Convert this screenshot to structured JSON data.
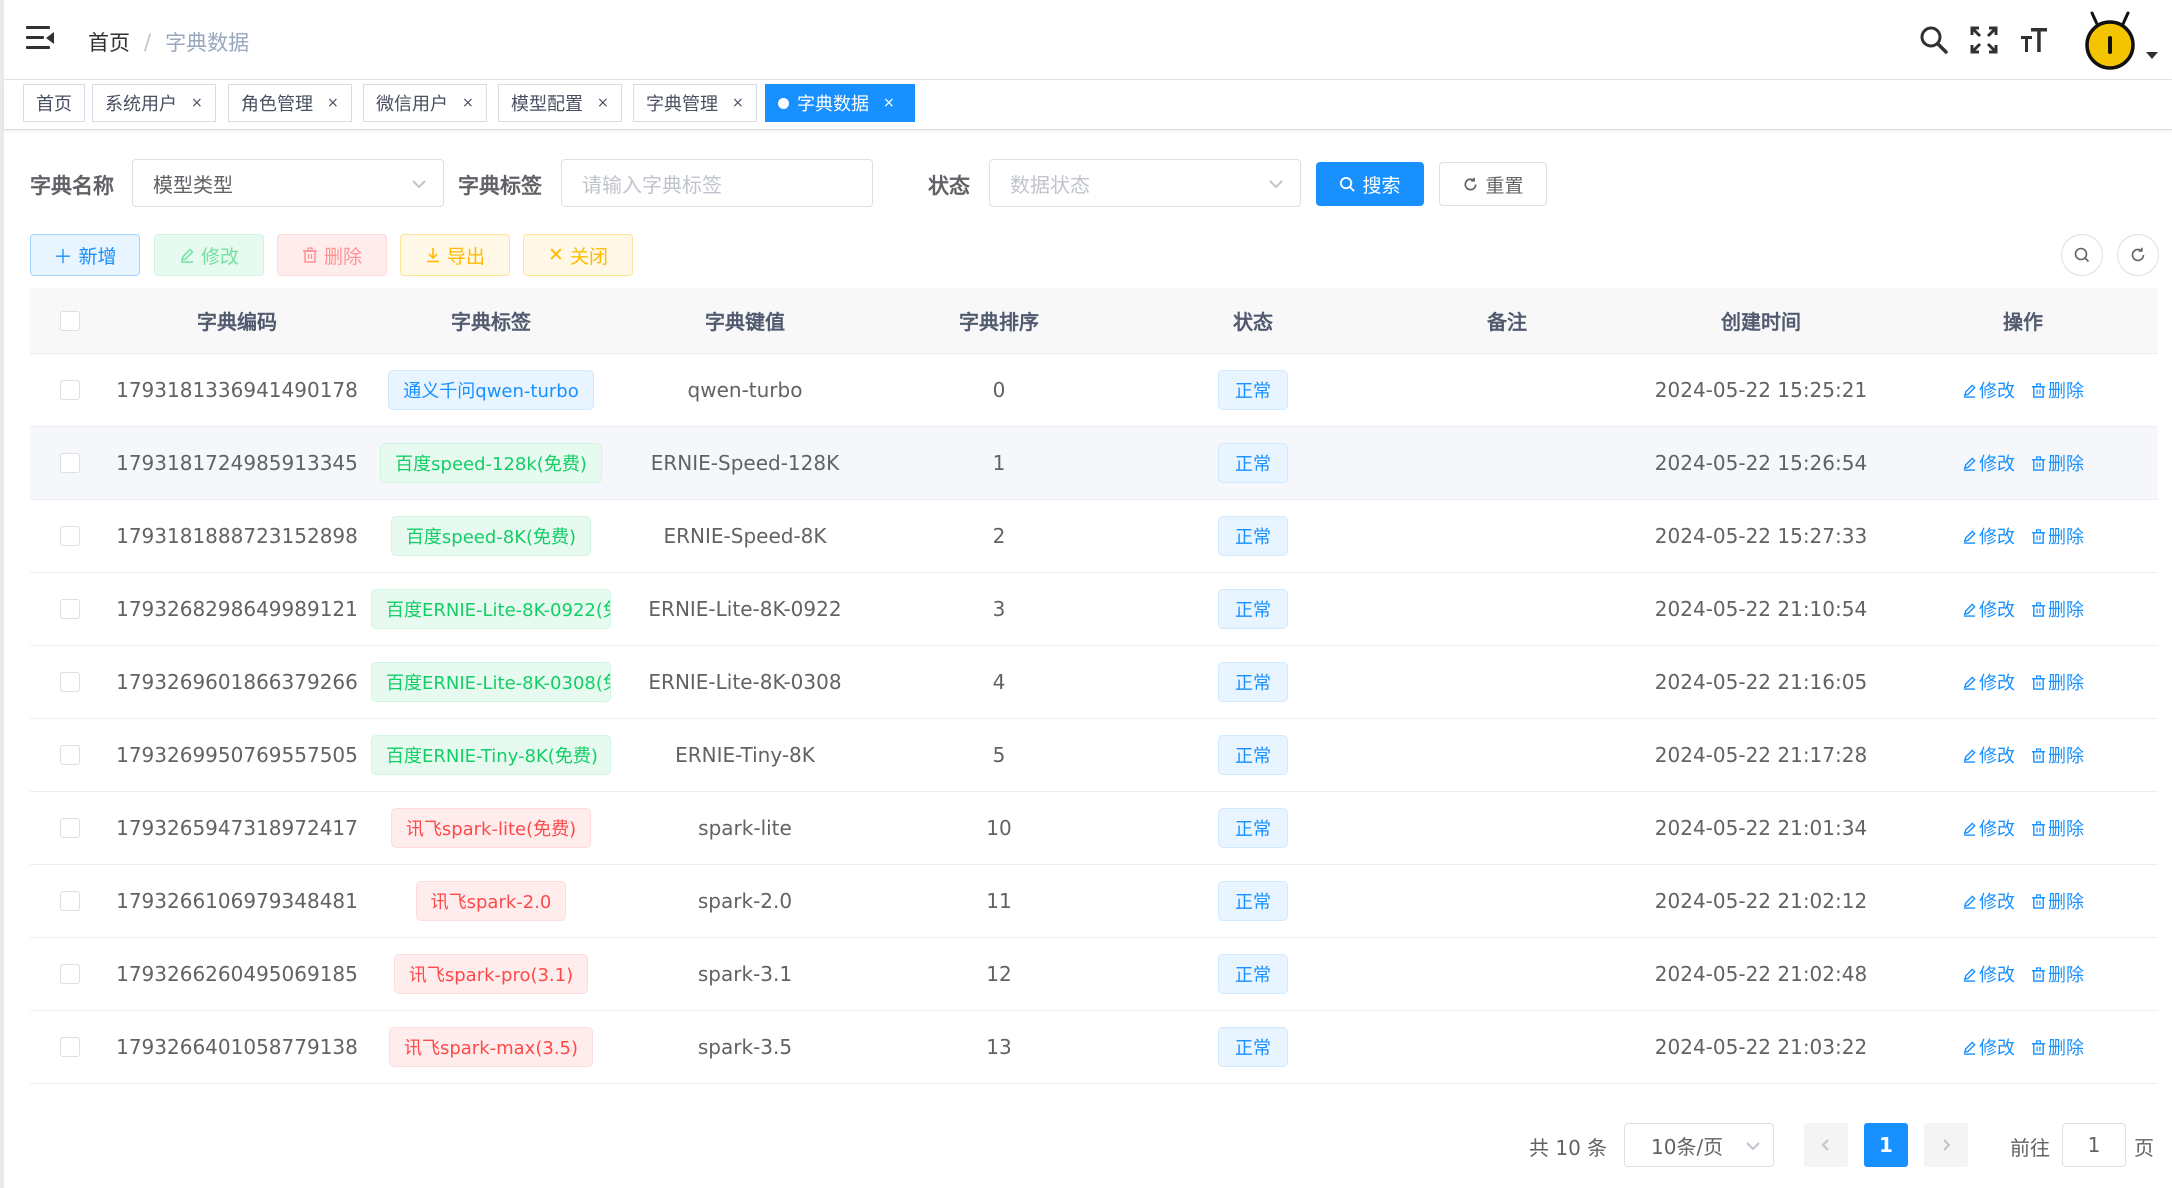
{
  "breadcrumb": {
    "home": "首页",
    "separator": "/",
    "current": "字典数据"
  },
  "tags": [
    {
      "label": "首页",
      "closable": false
    },
    {
      "label": "系统用户",
      "closable": true
    },
    {
      "label": "角色管理",
      "closable": true
    },
    {
      "label": "微信用户",
      "closable": true
    },
    {
      "label": "模型配置",
      "closable": true
    },
    {
      "label": "字典管理",
      "closable": true
    },
    {
      "label": "字典数据",
      "closable": true,
      "active": true
    }
  ],
  "tag_close": "×",
  "search": {
    "dict_name_label": "字典名称",
    "dict_name_value": "模型类型",
    "dict_label_label": "字典标签",
    "dict_label_placeholder": "请输入字典标签",
    "status_label": "状态",
    "status_placeholder": "数据状态",
    "search_button": "搜索",
    "reset_button": "重置"
  },
  "toolbar": {
    "add": "新增",
    "edit": "修改",
    "delete": "删除",
    "export": "导出",
    "close": "关闭"
  },
  "table": {
    "columns": [
      "字典编码",
      "字典标签",
      "字典键值",
      "字典排序",
      "状态",
      "备注",
      "创建时间",
      "操作"
    ],
    "rows": [
      {
        "code": "1793181336941490178",
        "label": "通义千问qwen-turbo",
        "label_type": "primary",
        "value": "qwen-turbo",
        "sort": "0",
        "status": "正常",
        "remark": "",
        "created": "2024-05-22 15:25:21"
      },
      {
        "code": "1793181724985913345",
        "label": "百度speed-128k(免费)",
        "label_type": "success",
        "value": "ERNIE-Speed-128K",
        "sort": "1",
        "status": "正常",
        "remark": "",
        "created": "2024-05-22 15:26:54"
      },
      {
        "code": "1793181888723152898",
        "label": "百度speed-8K(免费)",
        "label_type": "success",
        "value": "ERNIE-Speed-8K",
        "sort": "2",
        "status": "正常",
        "remark": "",
        "created": "2024-05-22 15:27:33"
      },
      {
        "code": "1793268298649989121",
        "label": "百度ERNIE-Lite-8K-0922(免",
        "label_type": "success",
        "value": "ERNIE-Lite-8K-0922",
        "sort": "3",
        "status": "正常",
        "remark": "",
        "created": "2024-05-22 21:10:54"
      },
      {
        "code": "1793269601866379266",
        "label": "百度ERNIE-Lite-8K-0308(免",
        "label_type": "success",
        "value": "ERNIE-Lite-8K-0308",
        "sort": "4",
        "status": "正常",
        "remark": "",
        "created": "2024-05-22 21:16:05"
      },
      {
        "code": "1793269950769557505",
        "label": "百度ERNIE-Tiny-8K(免费)",
        "label_type": "success",
        "value": "ERNIE-Tiny-8K",
        "sort": "5",
        "status": "正常",
        "remark": "",
        "created": "2024-05-22 21:17:28"
      },
      {
        "code": "1793265947318972417",
        "label": "讯飞spark-lite(免费)",
        "label_type": "danger",
        "value": "spark-lite",
        "sort": "10",
        "status": "正常",
        "remark": "",
        "created": "2024-05-22 21:01:34"
      },
      {
        "code": "1793266106979348481",
        "label": "讯飞spark-2.0",
        "label_type": "danger",
        "value": "spark-2.0",
        "sort": "11",
        "status": "正常",
        "remark": "",
        "created": "2024-05-22 21:02:12"
      },
      {
        "code": "1793266260495069185",
        "label": "讯飞spark-pro(3.1)",
        "label_type": "danger",
        "value": "spark-3.1",
        "sort": "12",
        "status": "正常",
        "remark": "",
        "created": "2024-05-22 21:02:48"
      },
      {
        "code": "1793266401058779138",
        "label": "讯飞spark-max(3.5)",
        "label_type": "danger",
        "value": "spark-3.5",
        "sort": "13",
        "status": "正常",
        "remark": "",
        "created": "2024-05-22 21:03:22"
      }
    ],
    "op_edit": "修改",
    "op_delete": "删除"
  },
  "pagination": {
    "total": "共 10 条",
    "page_size": "10条/页",
    "current_page": "1",
    "goto_label": "前往",
    "goto_value": "1",
    "page_suffix": "页"
  },
  "colors": {
    "primary": "#1890ff",
    "success": "#13ce66",
    "danger": "#ff4949",
    "warning": "#ffba00"
  },
  "icons": [
    "hamburger-icon",
    "search-icon",
    "fullscreen-icon",
    "font-size-icon",
    "avatar",
    "chevron-down-icon",
    "plus-icon",
    "edit-icon",
    "delete-icon",
    "download-icon",
    "close-icon",
    "refresh-icon"
  ]
}
